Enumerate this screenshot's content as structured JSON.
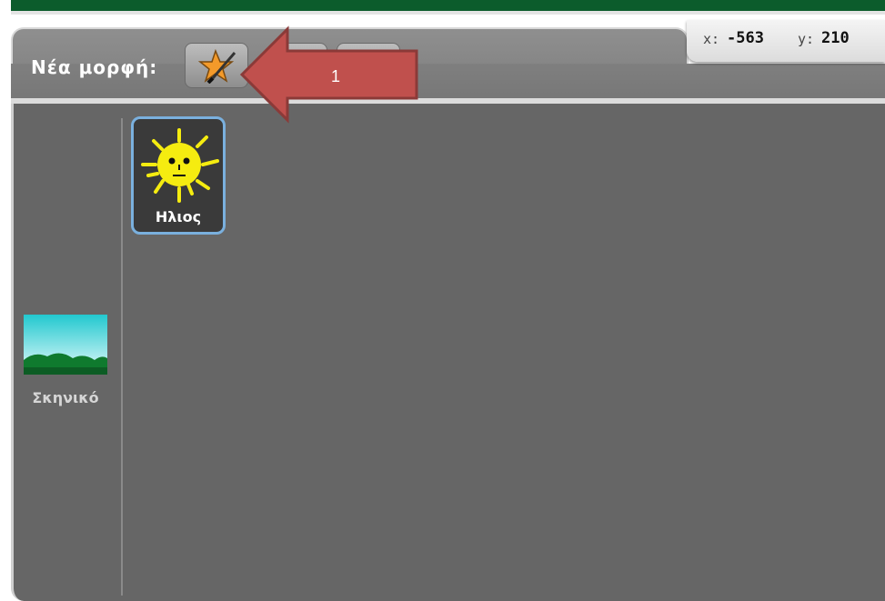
{
  "header": {
    "new_sprite_label": "Νέα μορφή:"
  },
  "coordinates": {
    "x_label": "x:",
    "x_value": "-563",
    "y_label": "y:",
    "y_value": "210"
  },
  "stage": {
    "label": "Σκηνικό"
  },
  "sprites": [
    {
      "name": "Ηλιος",
      "icon": "sun-face-icon"
    }
  ],
  "annotation": {
    "number": "1",
    "color": "#c0504d"
  },
  "colors": {
    "panel_bg": "#666666",
    "sprite_selection_border": "#7ab0de",
    "top_strip": "#0c5c2c"
  }
}
